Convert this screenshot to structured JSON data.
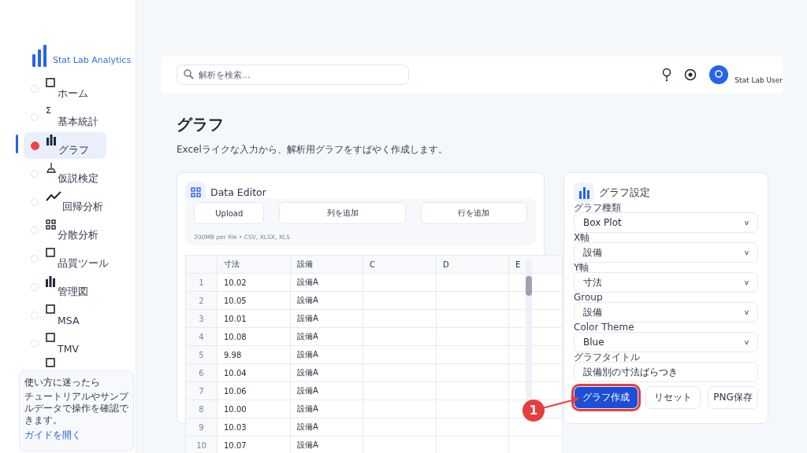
{
  "brand": {
    "name": "Stat Lab Analytics"
  },
  "sidebar": {
    "items": [
      {
        "label": "ホーム",
        "kind": "square",
        "selected": false
      },
      {
        "label": "基本統計",
        "kind": "glyph",
        "glyph": "Σ",
        "selected": false
      },
      {
        "label": "グラフ",
        "kind": "bars",
        "selected": true
      },
      {
        "label": "仮説検定",
        "kind": "flask",
        "selected": false
      },
      {
        "label": "回帰分析",
        "kind": "line",
        "selected": false
      },
      {
        "label": "分散分析",
        "kind": "grid",
        "selected": false
      },
      {
        "label": "品質ツール",
        "kind": "square",
        "selected": false
      },
      {
        "label": "管理図",
        "kind": "bars",
        "selected": false
      },
      {
        "label": "MSA",
        "kind": "square",
        "selected": false
      },
      {
        "label": "TMV",
        "kind": "square",
        "selected": false
      },
      {
        "kind": "square",
        "selected": false
      }
    ],
    "help": {
      "title": "使い方に迷ったら",
      "text": "チュートリアルやサンプルデータで操作を確認できます。",
      "link": "ガイドを開く"
    }
  },
  "topbar": {
    "search": {
      "placeholder": "解析を検索..."
    },
    "user": "Stat Lab User"
  },
  "page": {
    "title": "グラフ",
    "subtitle": "Excelライクな入力から、解析用グラフをすばやく作成します。"
  },
  "data_editor": {
    "title": "Data Editor",
    "buttons": [
      "Upload",
      "列を追加",
      "行を追加"
    ],
    "note": "200MB per file • CSV, XLSX, XLS",
    "table": {
      "columns": [
        "",
        "寸法",
        "設備",
        "C",
        "D",
        "E"
      ],
      "rows": [
        [
          "1",
          "10.02",
          "設備A"
        ],
        [
          "2",
          "10.05",
          "設備A"
        ],
        [
          "3",
          "10.01",
          "設備A"
        ],
        [
          "4",
          "10.08",
          "設備A"
        ],
        [
          "5",
          "9.98",
          "設備A"
        ],
        [
          "6",
          "10.04",
          "設備A"
        ],
        [
          "7",
          "10.06",
          "設備A"
        ],
        [
          "8",
          "10.00",
          "設備A"
        ],
        [
          "9",
          "10.03",
          "設備A"
        ],
        [
          "10",
          "10.07",
          "設備A"
        ]
      ]
    }
  },
  "graph_settings": {
    "title": "グラフ設定",
    "fields": [
      {
        "label": "グラフ種類",
        "value": "Box Plot",
        "kind": "select",
        "caret": "v"
      },
      {
        "label": "X軸",
        "value": "設備",
        "kind": "select",
        "caret": "v"
      },
      {
        "label": "Y軸",
        "value": "寸法",
        "kind": "select",
        "caret": "v"
      },
      {
        "label": "Group",
        "value": "設備",
        "kind": "select",
        "caret": "v"
      },
      {
        "label": "Color Theme",
        "value": "Blue",
        "kind": "select",
        "caret": "v"
      },
      {
        "label": "グラフタイトル",
        "value": "設備別の寸法ばらつき",
        "kind": "text"
      }
    ],
    "buttons": [
      {
        "label": "グラフ作成",
        "kind": "primary",
        "highlighted": true
      },
      {
        "label": "リセット",
        "kind": "plain",
        "highlighted": false
      },
      {
        "label": "PNG保存",
        "kind": "plain",
        "highlighted": false
      }
    ]
  },
  "annotation": {
    "number": "1"
  }
}
